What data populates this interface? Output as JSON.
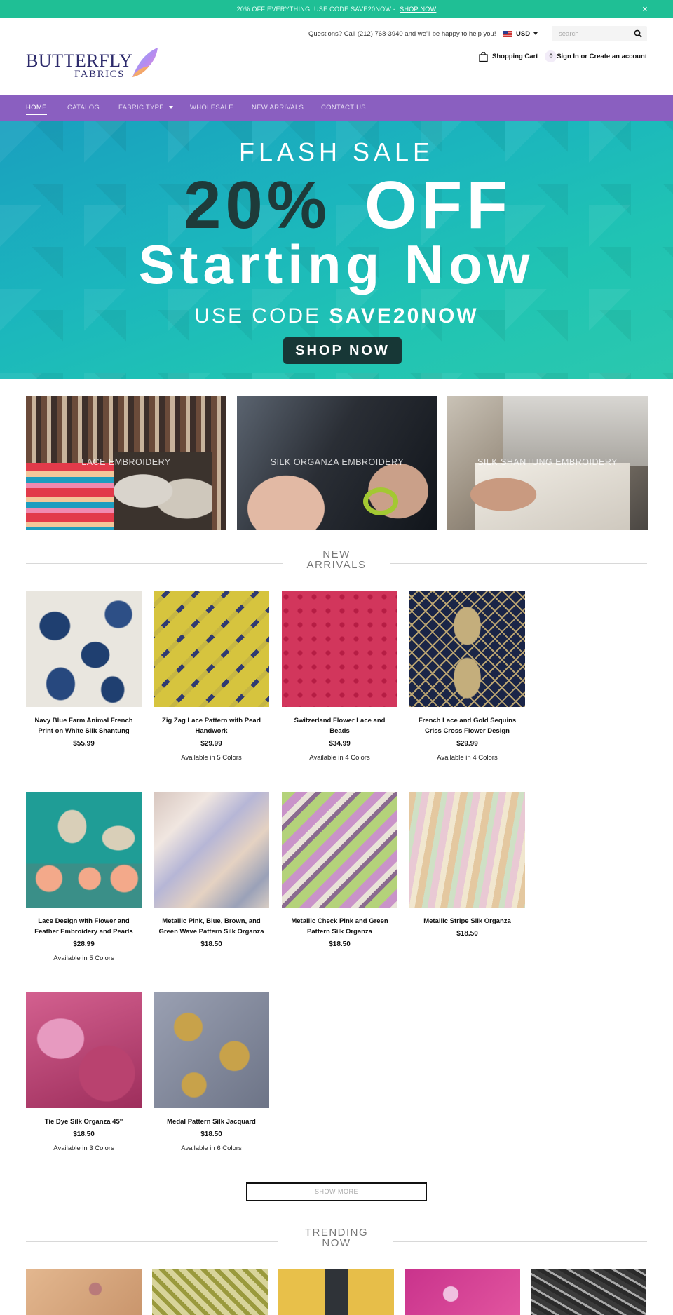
{
  "announcement": {
    "text": "20% OFF EVERYTHING. USE CODE SAVE20NOW -",
    "link": "SHOP NOW",
    "close": "×"
  },
  "header": {
    "questions": "Questions? Call (212) 768-3940 and we'll be happy to help you!",
    "currency": "USD",
    "search_placeholder": "search",
    "cart_label": "Shopping Cart",
    "cart_count": "0",
    "account": "Sign In or Create an account",
    "logo_line1": "BUTTERFLY",
    "logo_line2": "FABRICS"
  },
  "nav": {
    "home": "HOME",
    "catalog": "CATALOG",
    "fabric_type": "FABRIC TYPE",
    "wholesale": "WHOLESALE",
    "new_arrivals": "NEW ARRIVALS",
    "contact": "CONTACT US"
  },
  "hero": {
    "flash": "FLASH SALE",
    "pct": "20%",
    "off": "OFF",
    "starting": "Starting Now",
    "use_code": "USE CODE",
    "code": "SAVE20NOW",
    "button": "SHOP NOW"
  },
  "categories": [
    {
      "label": "LACE EMBROIDERY"
    },
    {
      "label": "SILK ORGANZA EMBROIDERY"
    },
    {
      "label": "SILK SHANTUNG EMBROIDERY"
    }
  ],
  "sections": {
    "new_arrivals_1": "NEW",
    "new_arrivals_2": "ARRIVALS",
    "trending_1": "TRENDING",
    "trending_2": "NOW"
  },
  "products": [
    {
      "name": "Navy Blue Farm Animal French Print on White Silk Shantung",
      "price": "$55.99",
      "colors": ""
    },
    {
      "name": "Zig Zag Lace Pattern with Pearl Handwork",
      "price": "$29.99",
      "colors": "Available in 5 Colors"
    },
    {
      "name": "Switzerland Flower Lace and Beads",
      "price": "$34.99",
      "colors": "Available in 4 Colors"
    },
    {
      "name": "French Lace and Gold Sequins Criss Cross Flower Design",
      "price": "$29.99",
      "colors": "Available in 4 Colors"
    },
    {
      "name": "Lace Design with Flower and Feather Embroidery and Pearls",
      "price": "$28.99",
      "colors": "Available in 5 Colors"
    },
    {
      "name": "Metallic Pink, Blue, Brown, and Green Wave Pattern Silk Organza",
      "price": "$18.50",
      "colors": ""
    },
    {
      "name": "Metallic Check Pink and Green Pattern Silk Organza",
      "price": "$18.50",
      "colors": ""
    },
    {
      "name": "Metallic Stripe Silk Organza",
      "price": "$18.50",
      "colors": ""
    },
    {
      "name": "Tie Dye Silk Organza 45''",
      "price": "$18.50",
      "colors": "Available in 3 Colors"
    },
    {
      "name": "Medal Pattern Silk Jacquard",
      "price": "$18.50",
      "colors": "Available in 6 Colors"
    }
  ],
  "show_more": "SHOW MORE",
  "colors": {
    "announcement": "#1fbf95",
    "nav": "#8a5fc0",
    "hero_button": "#173736",
    "logo": "#2c2a6b"
  }
}
